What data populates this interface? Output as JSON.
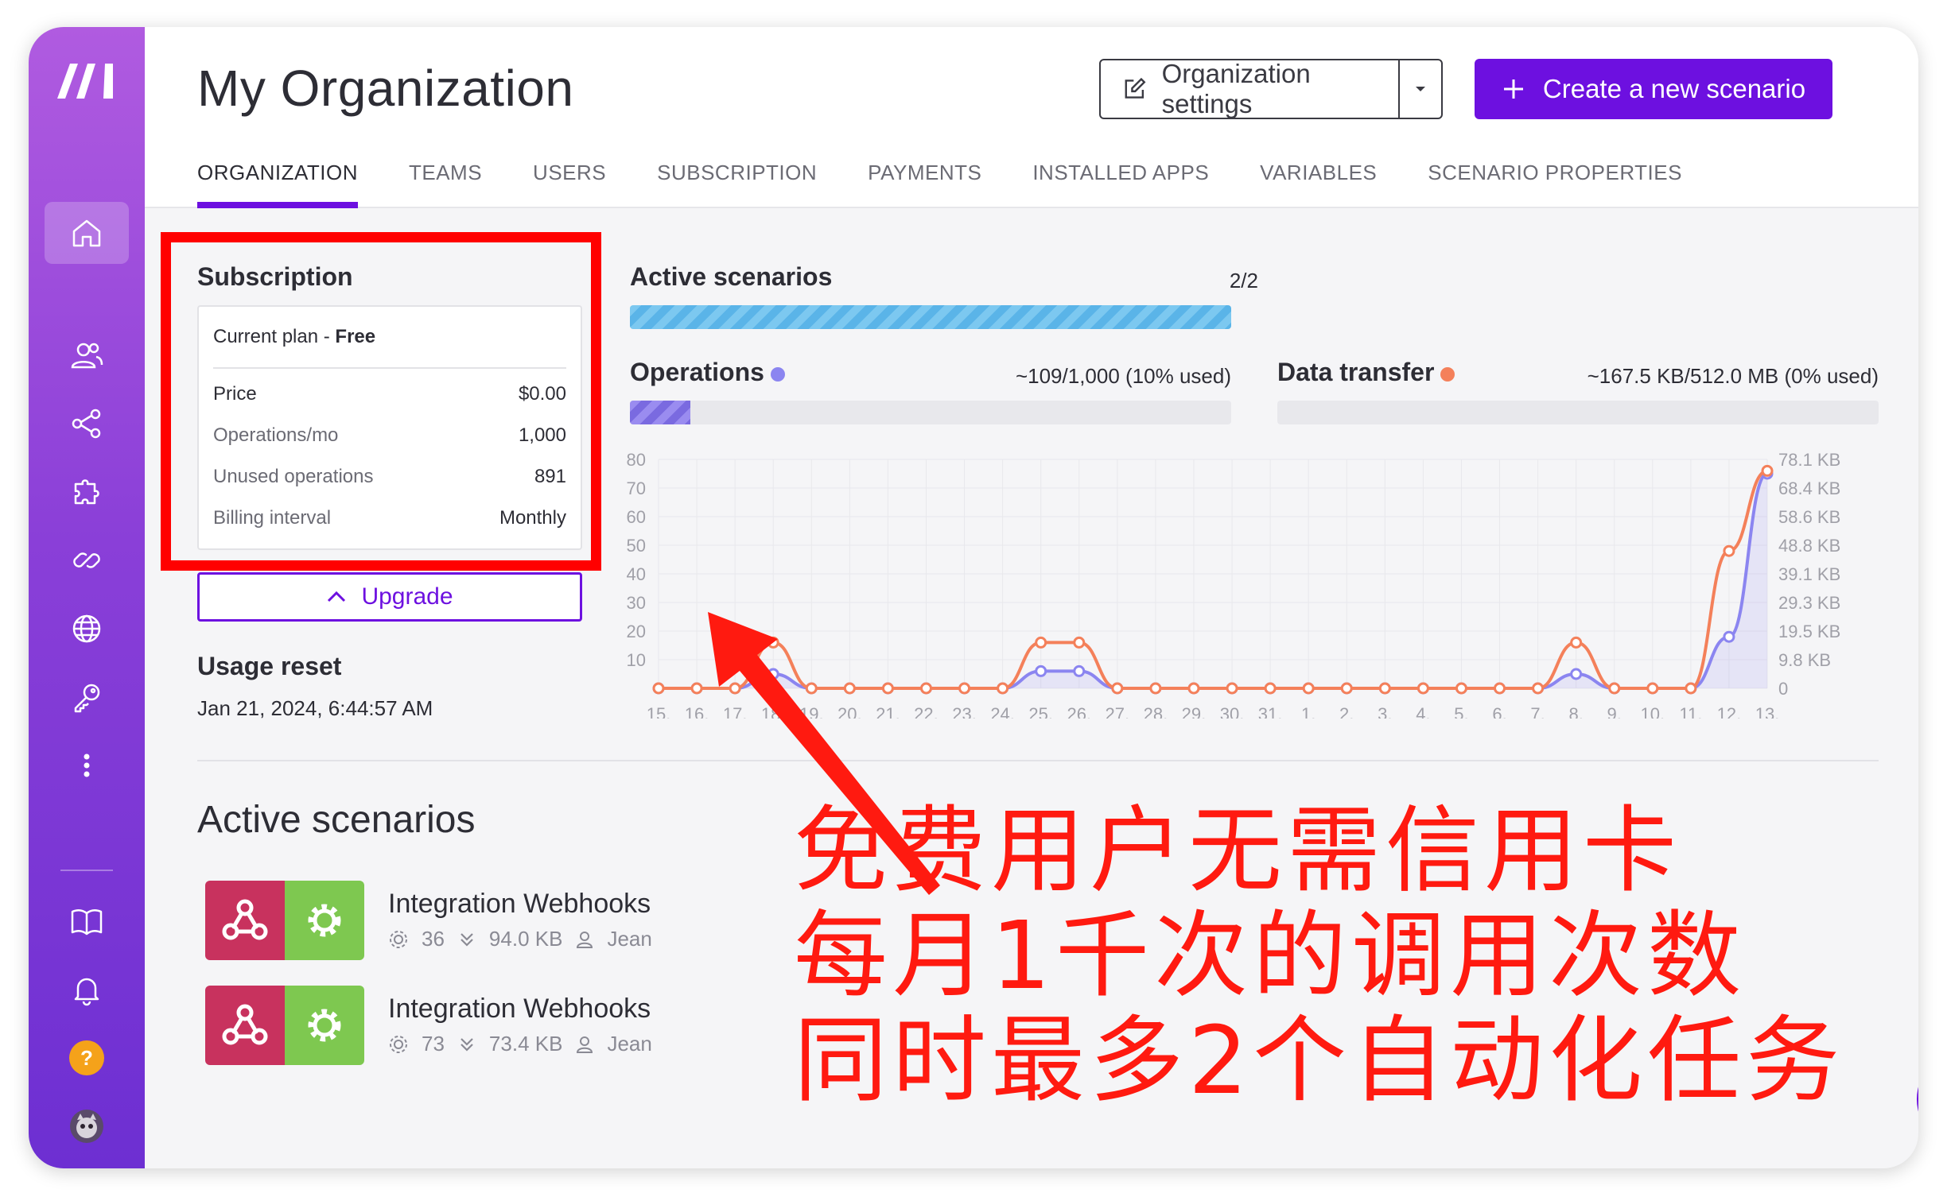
{
  "app": {
    "title": "My Organization",
    "org_settings_label": "Organization settings",
    "create_label": "Create a new scenario"
  },
  "tabs": [
    "ORGANIZATION",
    "TEAMS",
    "USERS",
    "SUBSCRIPTION",
    "PAYMENTS",
    "INSTALLED APPS",
    "VARIABLES",
    "SCENARIO PROPERTIES"
  ],
  "active_tab": "ORGANIZATION",
  "sidebar": {
    "icons": [
      "home-icon",
      "users-icon",
      "share-icon",
      "puzzle-icon",
      "link-icon",
      "globe-icon",
      "key-icon",
      "more-icon",
      "book-icon",
      "bell-icon",
      "help-icon",
      "avatar"
    ],
    "help_glyph": "?"
  },
  "subscription": {
    "title": "Subscription",
    "plan_prefix": "Current plan - ",
    "plan_name": "Free",
    "rows": [
      {
        "label": "Price",
        "value": "$0.00"
      },
      {
        "label": "Operations/mo",
        "value": "1,000"
      },
      {
        "label": "Unused operations",
        "value": "891"
      },
      {
        "label": "Billing interval",
        "value": "Monthly"
      }
    ],
    "upgrade_label": "Upgrade"
  },
  "usage_reset": {
    "title": "Usage reset",
    "value": "Jan 21, 2024, 6:44:57 AM"
  },
  "stats": {
    "active_scenarios": {
      "title": "Active scenarios",
      "value": "2/2",
      "fraction": 1.0
    },
    "operations": {
      "title": "Operations",
      "value": "~109/1,000 (10% used)",
      "fraction": 0.1,
      "color": "#8b85f0"
    },
    "data_transfer": {
      "title": "Data transfer",
      "value": "~167.5 KB/512.0 MB (0% used)",
      "fraction": 0.0,
      "color": "#f4805a"
    }
  },
  "chart_data": {
    "type": "line",
    "categories": [
      "15.",
      "16.",
      "17.",
      "18.",
      "19.",
      "20.",
      "21.",
      "22.",
      "23.",
      "24.",
      "25.",
      "26.",
      "27.",
      "28.",
      "29.",
      "30.",
      "31.",
      "1.",
      "2.",
      "3.",
      "4.",
      "5.",
      "6.",
      "7.",
      "8.",
      "9.",
      "10.",
      "11.",
      "12.",
      "13."
    ],
    "left_ticks": [
      "80",
      "70",
      "60",
      "50",
      "40",
      "30",
      "20",
      "10"
    ],
    "right_ticks": [
      "78.1 KB",
      "68.4 KB",
      "58.6 KB",
      "48.8 KB",
      "39.1 KB",
      "29.3 KB",
      "19.5 KB",
      "9.8 KB",
      "0"
    ],
    "ylim": [
      0,
      80
    ],
    "series": [
      {
        "name": "Operations",
        "color": "#8b85f0",
        "values": [
          0,
          0,
          0,
          5,
          0,
          0,
          0,
          0,
          0,
          0,
          6,
          6,
          0,
          0,
          0,
          0,
          0,
          0,
          0,
          0,
          0,
          0,
          0,
          0,
          5,
          0,
          0,
          0,
          18,
          75
        ]
      },
      {
        "name": "Data transfer",
        "color": "#f4805a",
        "values": [
          0,
          0,
          0,
          16,
          0,
          0,
          0,
          0,
          0,
          0,
          16,
          16,
          0,
          0,
          0,
          0,
          0,
          0,
          0,
          0,
          0,
          0,
          0,
          0,
          16,
          0,
          0,
          0,
          48,
          76
        ]
      }
    ]
  },
  "active_scenarios": {
    "title": "Active scenarios",
    "items": [
      {
        "name": "Integration Webhooks",
        "ops": "36",
        "size": "94.0 KB",
        "user": "Jean"
      },
      {
        "name": "Integration Webhooks",
        "ops": "73",
        "size": "73.4 KB",
        "user": "Jean"
      }
    ]
  },
  "annotation": {
    "lines": [
      "免费用户无需信用卡",
      "每月1千次的调用次数",
      "同时最多2个自动化任务"
    ],
    "color": "#ff1a10"
  }
}
